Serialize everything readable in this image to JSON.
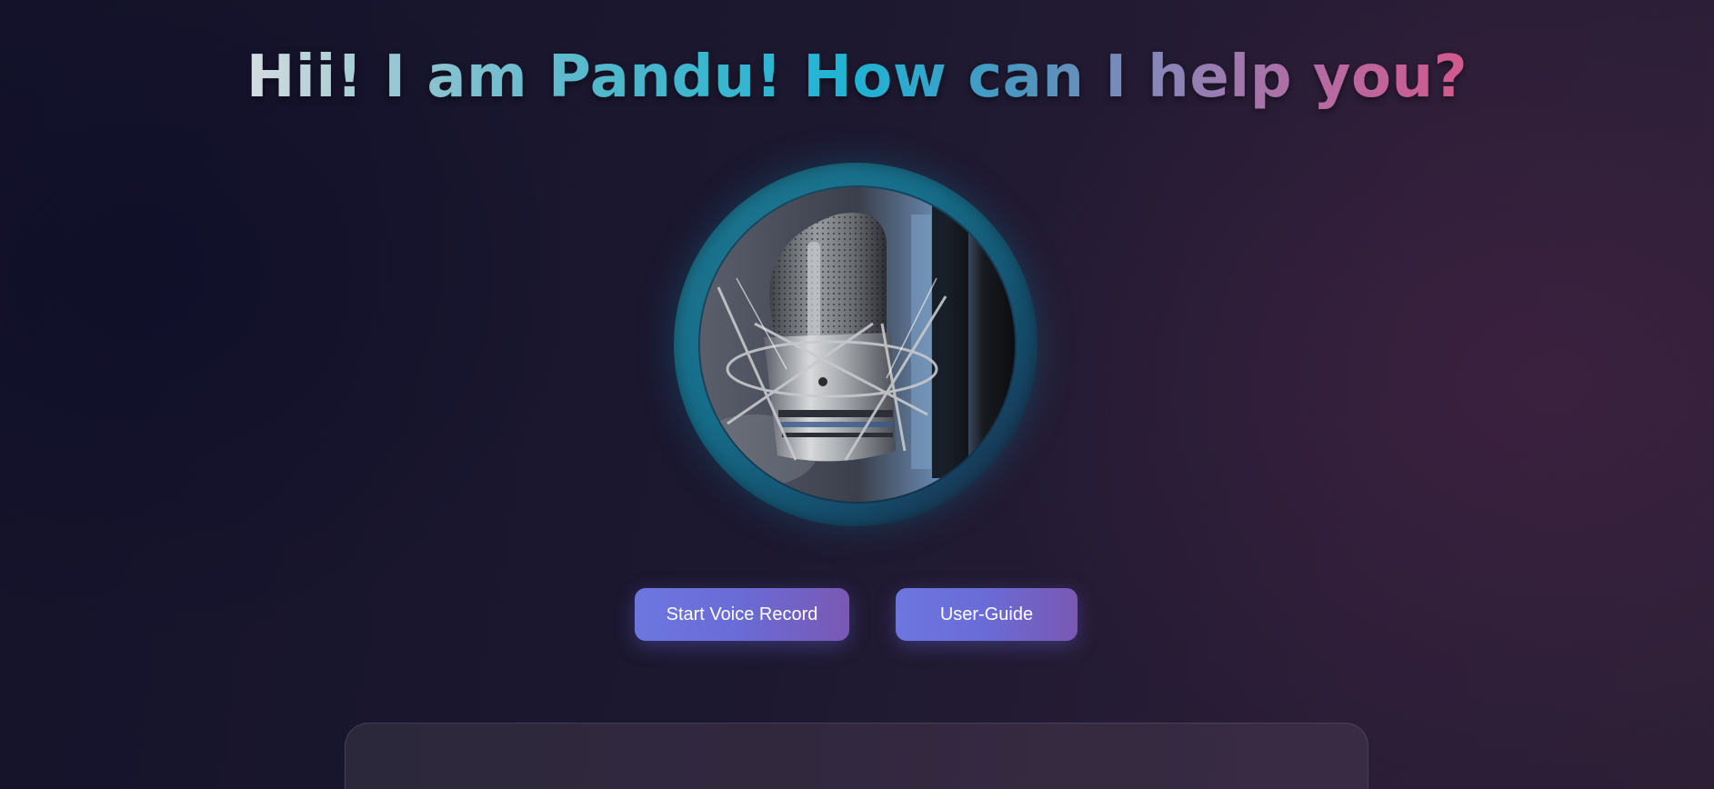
{
  "header": {
    "title": "Hii! I am Pandu! How can I help you?"
  },
  "hero": {
    "image_icon": "microphone-icon"
  },
  "actions": {
    "record_label": "Start Voice Record",
    "guide_label": "User-Guide"
  },
  "colors": {
    "button_gradient_start": "#6d76e0",
    "button_gradient_end": "#7a58b4",
    "ring_teal": "#1f7790",
    "title_gradient": [
      "#d5dde2",
      "#1fb3d4",
      "#d2588e"
    ]
  }
}
